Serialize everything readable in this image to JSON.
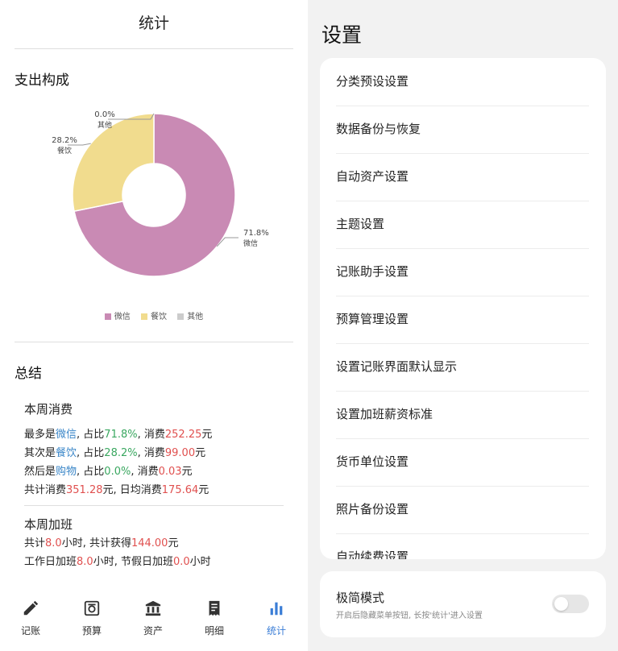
{
  "left": {
    "title": "统计",
    "expense_section": "支出构成",
    "summary_section": "总结"
  },
  "chart_data": {
    "type": "pie",
    "donut": true,
    "categories": [
      "微信",
      "餐饮",
      "其他"
    ],
    "values": [
      71.8,
      28.2,
      0.0
    ],
    "value_labels": [
      "71.8%",
      "28.2%",
      "0.0%"
    ],
    "colors": [
      "#c98ab4",
      "#f1dc8e",
      "#cccccc"
    ],
    "legend_placement": "bottom-center"
  },
  "summary": {
    "week_expense": {
      "heading": "本周消费",
      "line1": {
        "a": "最多是",
        "b": "微信",
        "c": ", 占比",
        "d": "71.8%",
        "e": ", 消费",
        "f": "252.25",
        "g": "元"
      },
      "line2": {
        "a": "其次是",
        "b": "餐饮",
        "c": ", 占比",
        "d": "28.2%",
        "e": ", 消费",
        "f": "99.00",
        "g": "元"
      },
      "line3": {
        "a": "然后是",
        "b": "购物",
        "c": ", 占比",
        "d": "0.0%",
        "e": ", 消费",
        "f": "0.03",
        "g": "元"
      },
      "line4": {
        "a": "共计消费",
        "b": "351.28",
        "c": "元, 日均消费",
        "d": "175.64",
        "e": "元"
      }
    },
    "week_overtime": {
      "heading": "本周加班",
      "line1": {
        "a": "共计",
        "b": "8.0",
        "c": "小时, 共计获得",
        "d": "144.00",
        "e": "元"
      },
      "line2": {
        "a": "工作日加班",
        "b": "8.0",
        "c": "小时, 节假日加班",
        "d": "0.0",
        "e": "小时"
      }
    }
  },
  "nav": [
    {
      "label": "记账",
      "icon": "pencil-icon"
    },
    {
      "label": "预算",
      "icon": "budget-icon"
    },
    {
      "label": "资产",
      "icon": "bank-icon"
    },
    {
      "label": "明细",
      "icon": "receipt-icon"
    },
    {
      "label": "统计",
      "icon": "bar-chart-icon",
      "active": true
    }
  ],
  "settings": {
    "title": "设置",
    "items": [
      "分类预设设置",
      "数据备份与恢复",
      "自动资产设置",
      "主题设置",
      "记账助手设置",
      "预算管理设置",
      "设置记账界面默认显示",
      "设置加班薪资标准",
      "货币单位设置",
      "照片备份设置",
      "自动续费设置"
    ],
    "minimal_mode": {
      "title": "极简模式",
      "subtitle": "开启后隐藏菜单按钮, 长按'统计'进入设置",
      "enabled": false
    }
  }
}
